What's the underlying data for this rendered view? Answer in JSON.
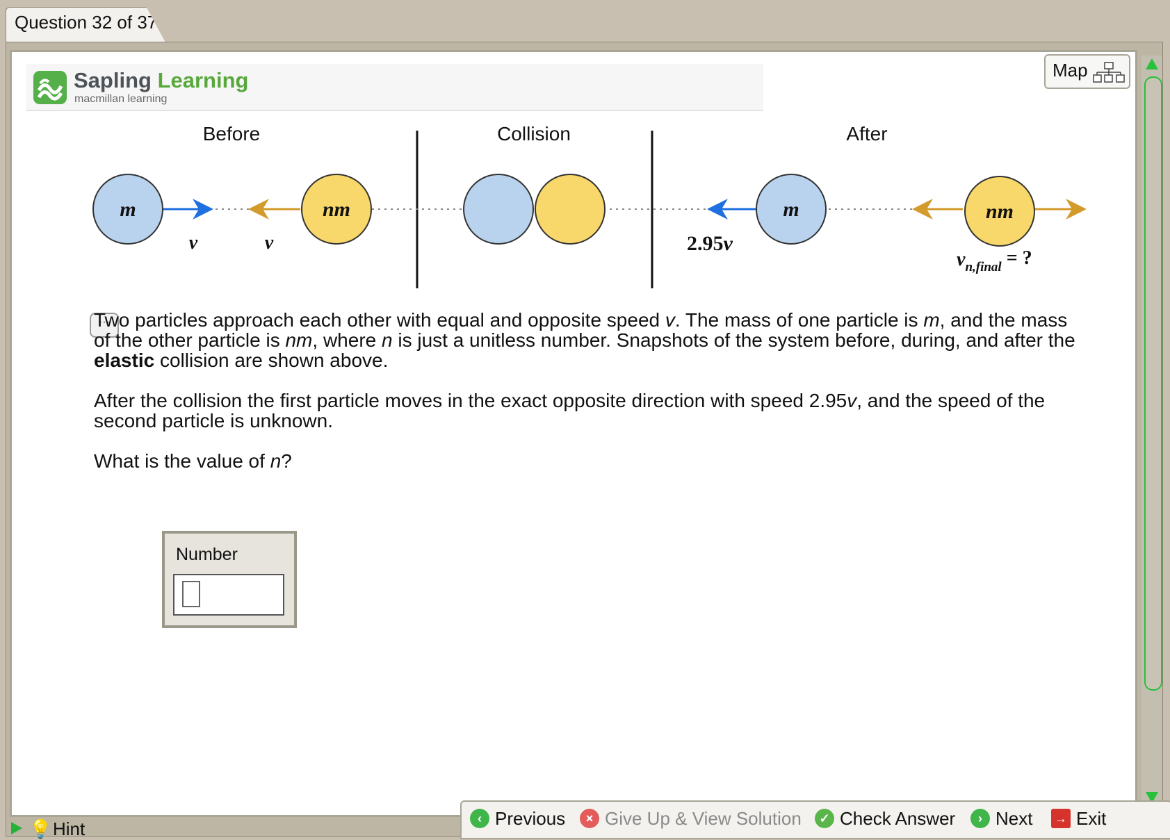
{
  "tab": {
    "label": "Question 32 of 37"
  },
  "header": {
    "logo_name_a": "Sapling ",
    "logo_name_b": "Learning",
    "logo_sub": "macmillan learning",
    "map_label": "Map"
  },
  "diagram": {
    "before_label": "Before",
    "collision_label": "Collision",
    "after_label": "After",
    "mass_small": "m",
    "mass_large": "nm",
    "speed_before_left": "v",
    "speed_before_right": "v",
    "speed_after_small": "2.95",
    "speed_after_small_unit": "v",
    "vfinal_sym": "v",
    "vfinal_sub": "n,final",
    "vfinal_eq": " = ?",
    "colors": {
      "blue_ball": "#b9d3ef",
      "yellow_ball": "#f8d86a",
      "blue_arrow": "#1e6fe0",
      "gold_arrow": "#d39a2c"
    }
  },
  "question": {
    "p1_a": "Two particles approach each other with equal and opposite speed ",
    "p1_v": "v",
    "p1_b": ".  The mass of one particle is ",
    "p1_m": "m",
    "p1_c": ", and the mass of the other particle is ",
    "p1_nm": "nm",
    "p1_d": ", where ",
    "p1_n": "n",
    "p1_e": " is just a unitless number.  Snapshots of the system before, during, and after the ",
    "p1_bold": "elastic",
    "p1_f": " collision are shown above.",
    "p2_a": "After the collision the first particle moves in the exact opposite direction with speed 2.95",
    "p2_v": "v",
    "p2_b": ", and the speed of the second particle is unknown.",
    "p3_a": "What is the value of ",
    "p3_n": "n",
    "p3_b": "?"
  },
  "answer": {
    "label": "Number",
    "value": ""
  },
  "comment_icon": "comment-bubble-icon",
  "footer": {
    "hint": "Hint",
    "previous": "Previous",
    "give_up": "Give Up & View Solution",
    "check": "Check Answer",
    "next": "Next",
    "exit": "Exit"
  }
}
